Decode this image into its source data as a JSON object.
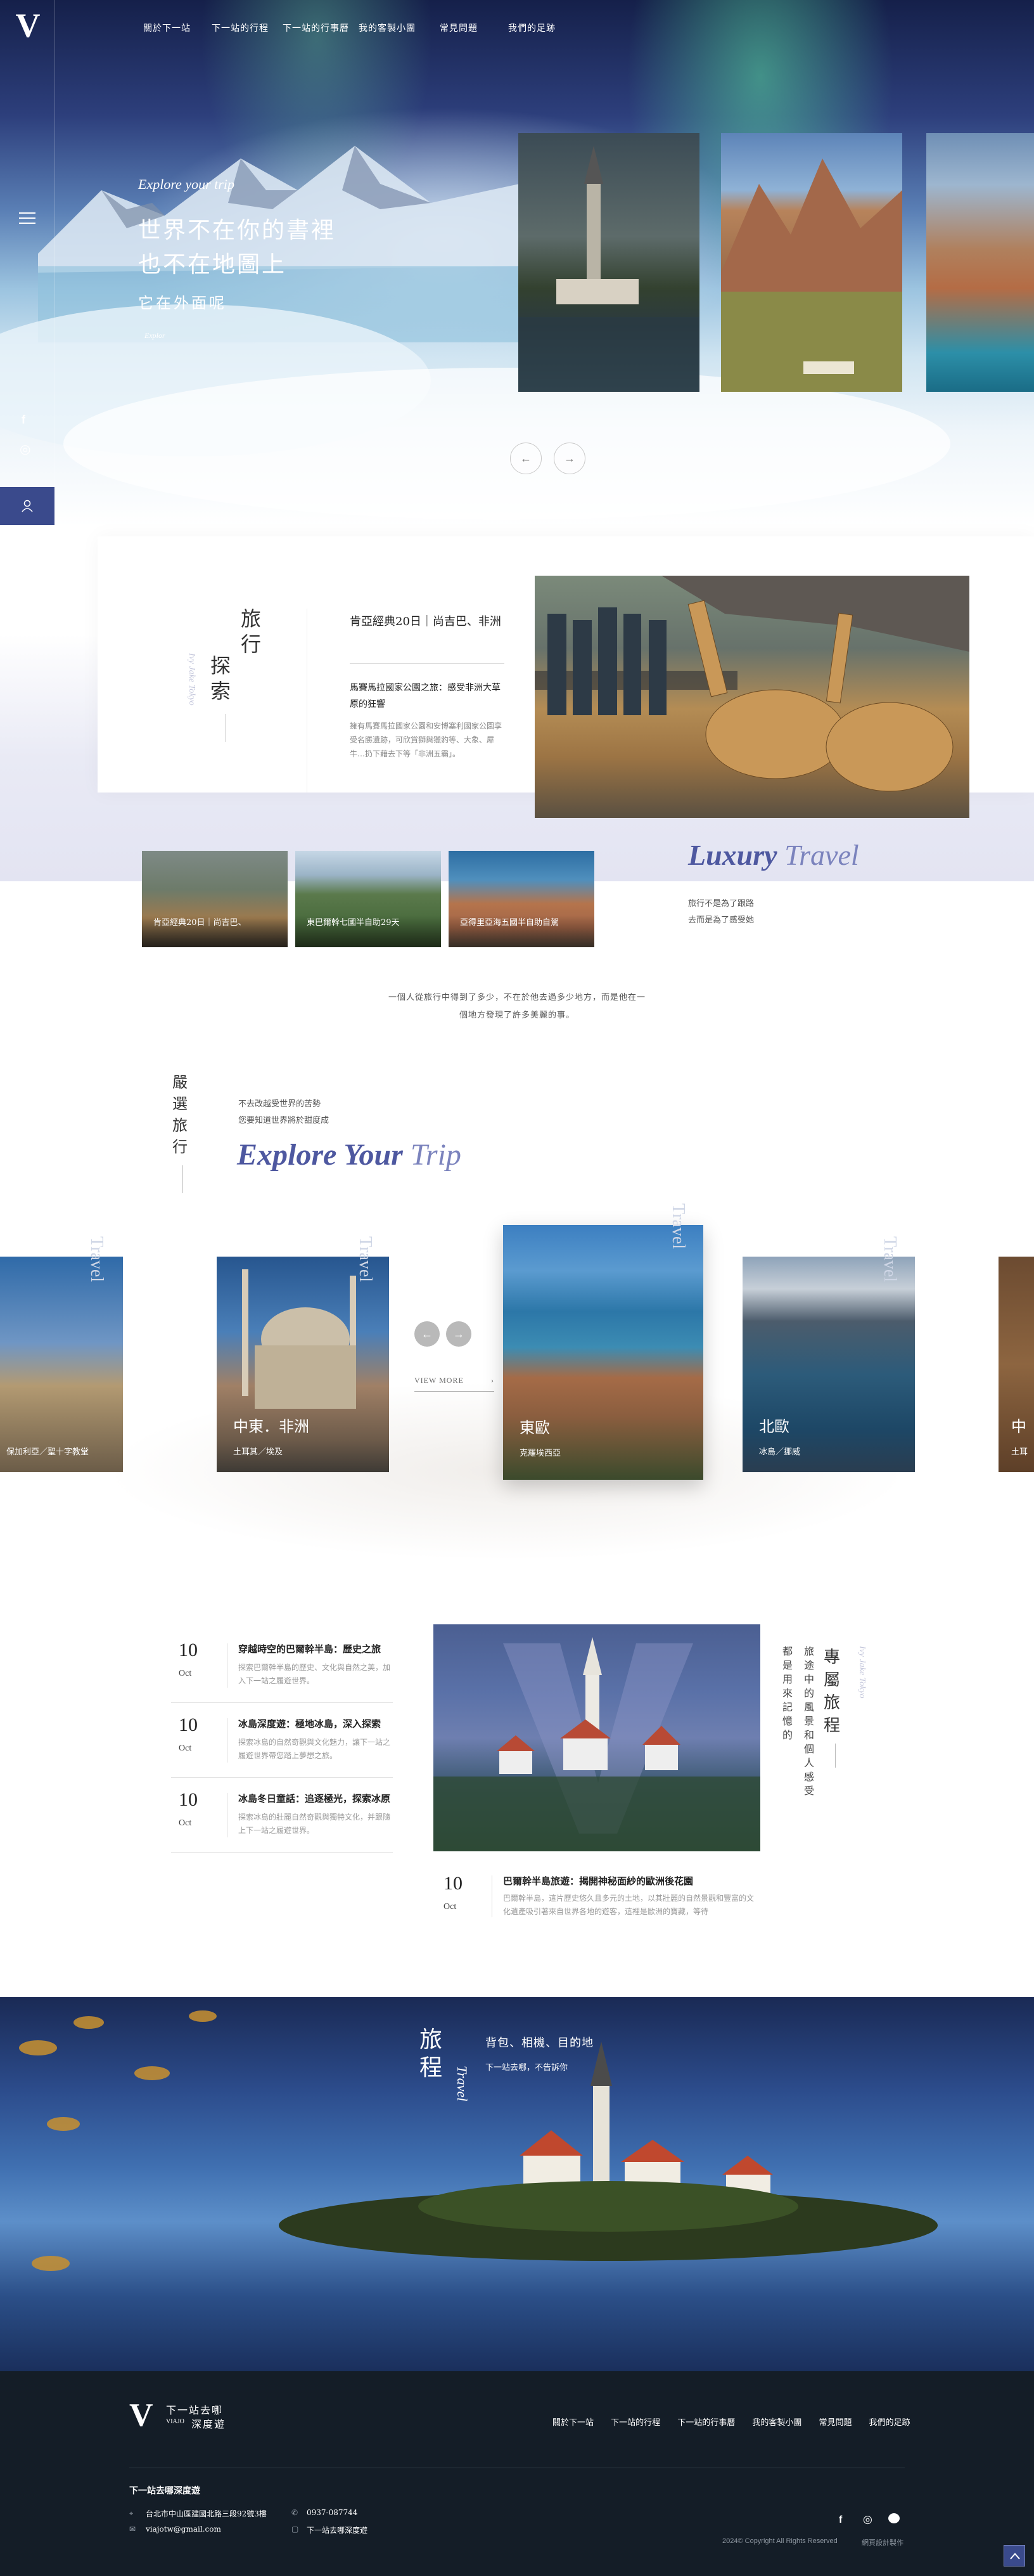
{
  "brand": {
    "logo_letter": "V",
    "name_cn": "下一站去哪",
    "sub_cn": "深度遊",
    "sub_en": "VIAJO"
  },
  "nav": {
    "items": [
      "關於下一站",
      "下一站的行程",
      "下一站的行事曆",
      "我的客製小團",
      "常見問題",
      "我們的足跡"
    ]
  },
  "hero": {
    "kicker": "Explore your trip",
    "line1": "世界不在你的書裡",
    "line2": "也不在地圖上",
    "line3": "它在外面呢",
    "link": "Explor"
  },
  "sidebar": {
    "facebook": "f",
    "instagram": "◎",
    "member": "user"
  },
  "explore": {
    "title_cn": "旅行探索",
    "title_en": "Ivy Jake Tokyo",
    "featured_title": "肯亞經典20日｜尚吉巴、非洲",
    "featured_sub": "馬賽馬拉國家公園之旅：感受非洲大草原的狂響",
    "featured_desc": "擁有馬賽馬拉國家公園和安博塞利國家公園享受名勝遺跡，可欣賞獅與獵豹等、大象、犀牛…扔下藉去下等「非洲五霸」。"
  },
  "thumbs": [
    {
      "label": "肯亞經典20日｜尚吉巴、"
    },
    {
      "label": "東巴爾幹七國半自助29天"
    },
    {
      "label": "亞得里亞海五國半自助自駕"
    }
  ],
  "luxury": {
    "word1": "Luxury",
    "word2": "Travel",
    "line1": "旅行不是為了跟路",
    "line2": "去而是為了感受她"
  },
  "quote": {
    "line1": "一個人從旅行中得到了多少，不在於他去過多少地方，而是他在一",
    "line2": "個地方發現了許多美麗的事。"
  },
  "selected": {
    "title_cn": "嚴選旅行",
    "line1": "不去改越受世界的苦勢",
    "line2": "您要知道世界將於甜度成",
    "heading_a": "Explore Your",
    "heading_b": "Trip",
    "view_more": "VIEW MORE"
  },
  "trips": [
    {
      "title": "",
      "sub": "保加利亞／聖十字教堂"
    },
    {
      "title": "中東．非洲",
      "sub": "土耳其／埃及"
    },
    {
      "title": "東歐",
      "sub": "克羅埃西亞"
    },
    {
      "title": "北歐",
      "sub": "冰島／挪威"
    },
    {
      "title": "中",
      "sub": "土耳"
    }
  ],
  "trip_tag": "Travel",
  "news": [
    {
      "day": "10",
      "mon": "Oct",
      "title": "穿越時空的巴爾幹半島：歷史之旅",
      "desc": "探索巴爾幹半島的歷史、文化與自然之美，加入下一站之履遊世界。"
    },
    {
      "day": "10",
      "mon": "Oct",
      "title": "冰島深度遊：極地冰島，深入探索",
      "desc": "探索冰島的自然奇觀與文化魅力，讓下一站之履遊世界帶您踏上夢想之旅。"
    },
    {
      "day": "10",
      "mon": "Oct",
      "title": "冰島冬日童話：追逐極光，探索冰原",
      "desc": "探索冰島的壯麗自然奇觀與獨特文化，并跟隨上下一站之履遊世界。"
    }
  ],
  "feature_article": {
    "day": "10",
    "mon": "Oct",
    "title": "巴爾幹半島旅遊：揭開神秘面紗的歐洲後花園",
    "desc": "巴爾幹半島，這片歷史悠久且多元的土地，以其壯麗的自然景觀和豐富的文化遺產吸引著來自世界各地的遊客，這裡是歐洲的寶藏，等待"
  },
  "special": {
    "title_cn": "專屬旅程",
    "title_en": "Ivy Jake Tokyo",
    "col1": "旅途中的風景和個人感受",
    "col2": "都是用來記憶的"
  },
  "banner": {
    "cn": "旅程",
    "en": "Travel",
    "line1": "背包、相機、目的地",
    "line2": "下一站去哪，不告訴你"
  },
  "footer": {
    "nav": [
      "關於下一站",
      "下一站的行程",
      "下一站的行事曆",
      "我的客製小團",
      "常見問題",
      "我們的足跡"
    ],
    "company": "下一站去哪深度遊",
    "address": "台北市中山區建國北路三段92號3樓",
    "phone": "0937-087744",
    "email": "viajotw@gmail.com",
    "line_id": "下一站去哪深度遊",
    "copyright": "2024© Copyright All Rights Reserved",
    "credit": "網頁設計製作"
  },
  "colors": {
    "accent": "#5b65a8",
    "dark_footer": "#141d27",
    "sidebar_btn": "#3a4a8c"
  }
}
